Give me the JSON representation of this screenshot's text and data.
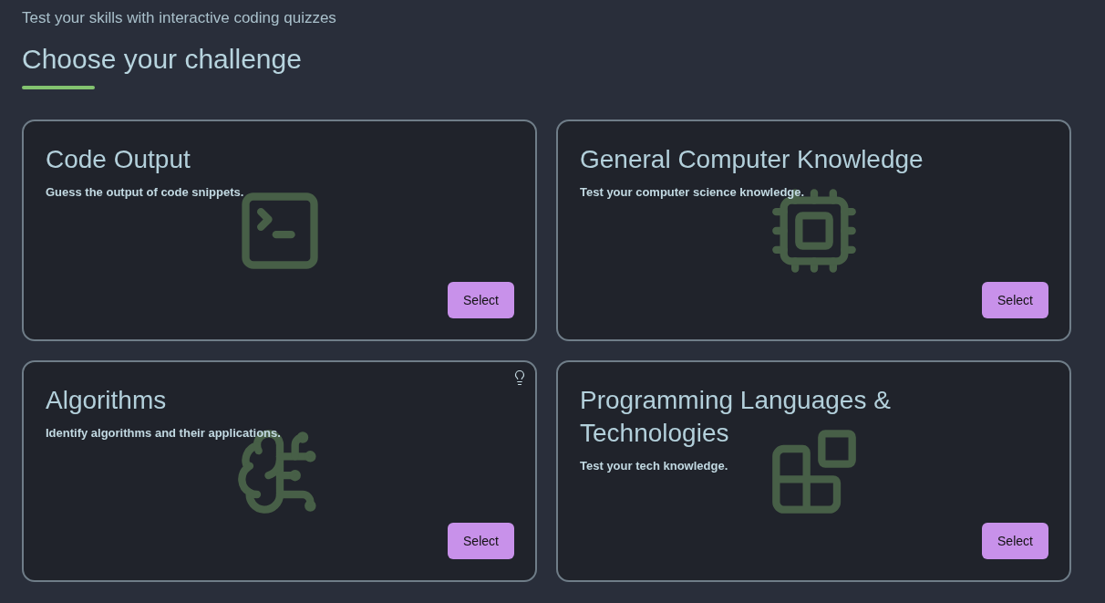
{
  "header": {
    "subtitle": "Test your skills with interactive coding quizzes",
    "title": "Choose your challenge"
  },
  "cards": [
    {
      "title": "Code Output",
      "description": "Guess the output of code snippets.",
      "button": "Select",
      "hint": false
    },
    {
      "title": "General Computer Knowledge",
      "description": "Test your computer science knowledge.",
      "button": "Select",
      "hint": false
    },
    {
      "title": "Algorithms",
      "description": "Identify algorithms and their applications.",
      "button": "Select",
      "hint": true
    },
    {
      "title": "Programming Languages & Technologies",
      "description": "Test your tech knowledge.",
      "button": "Select",
      "hint": false
    }
  ]
}
